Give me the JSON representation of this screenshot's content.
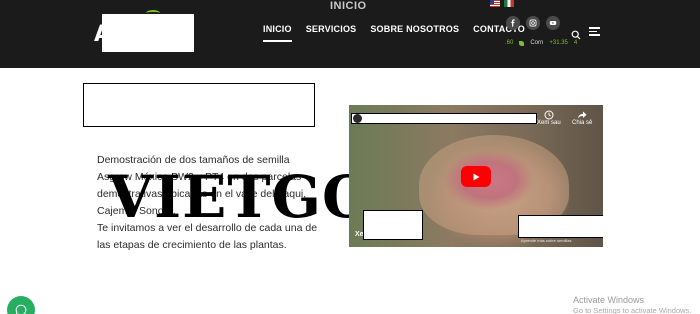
{
  "header": {
    "top_title": "INICIO",
    "logo_letter": "A",
    "nav": [
      {
        "label": "INICIO",
        "active": true
      },
      {
        "label": "SERVICIOS",
        "active": false
      },
      {
        "label": "SOBRE NOSOTROS",
        "active": false
      },
      {
        "label": "CONTACTO",
        "active": false
      }
    ],
    "flags": [
      "us-flag-icon",
      "mexico-flag-icon"
    ],
    "social": [
      "facebook-icon",
      "instagram-icon",
      "youtube-icon"
    ],
    "ticker": {
      "left_value": ".60",
      "label": "Corn",
      "value": "+31.35",
      "right_value": "4"
    },
    "accent_color": "#7bbf2a"
  },
  "main": {
    "paragraph_lines": [
      "Demostración de dos tamaños de semilla",
      "Asgrow México BW2 y PT4 en dos parcelas",
      "demostrativas ubicadas en el valle del Yaqui,",
      "Cajeme, Sonora.",
      "Te invitamos a ver el desarrollo de cada una de",
      "las etapas de crecimiento de las plantas."
    ],
    "watermark": "VIETGO"
  },
  "video": {
    "watch_later": "Xem sau",
    "share": "Chia sẻ",
    "sublabel": "Xe",
    "caption": "Aprende más sobre semillas",
    "play_color": "#ff0000"
  },
  "windows_notice": {
    "title": "Activate Windows",
    "subtitle": "Go to Settings to activate Windows."
  }
}
